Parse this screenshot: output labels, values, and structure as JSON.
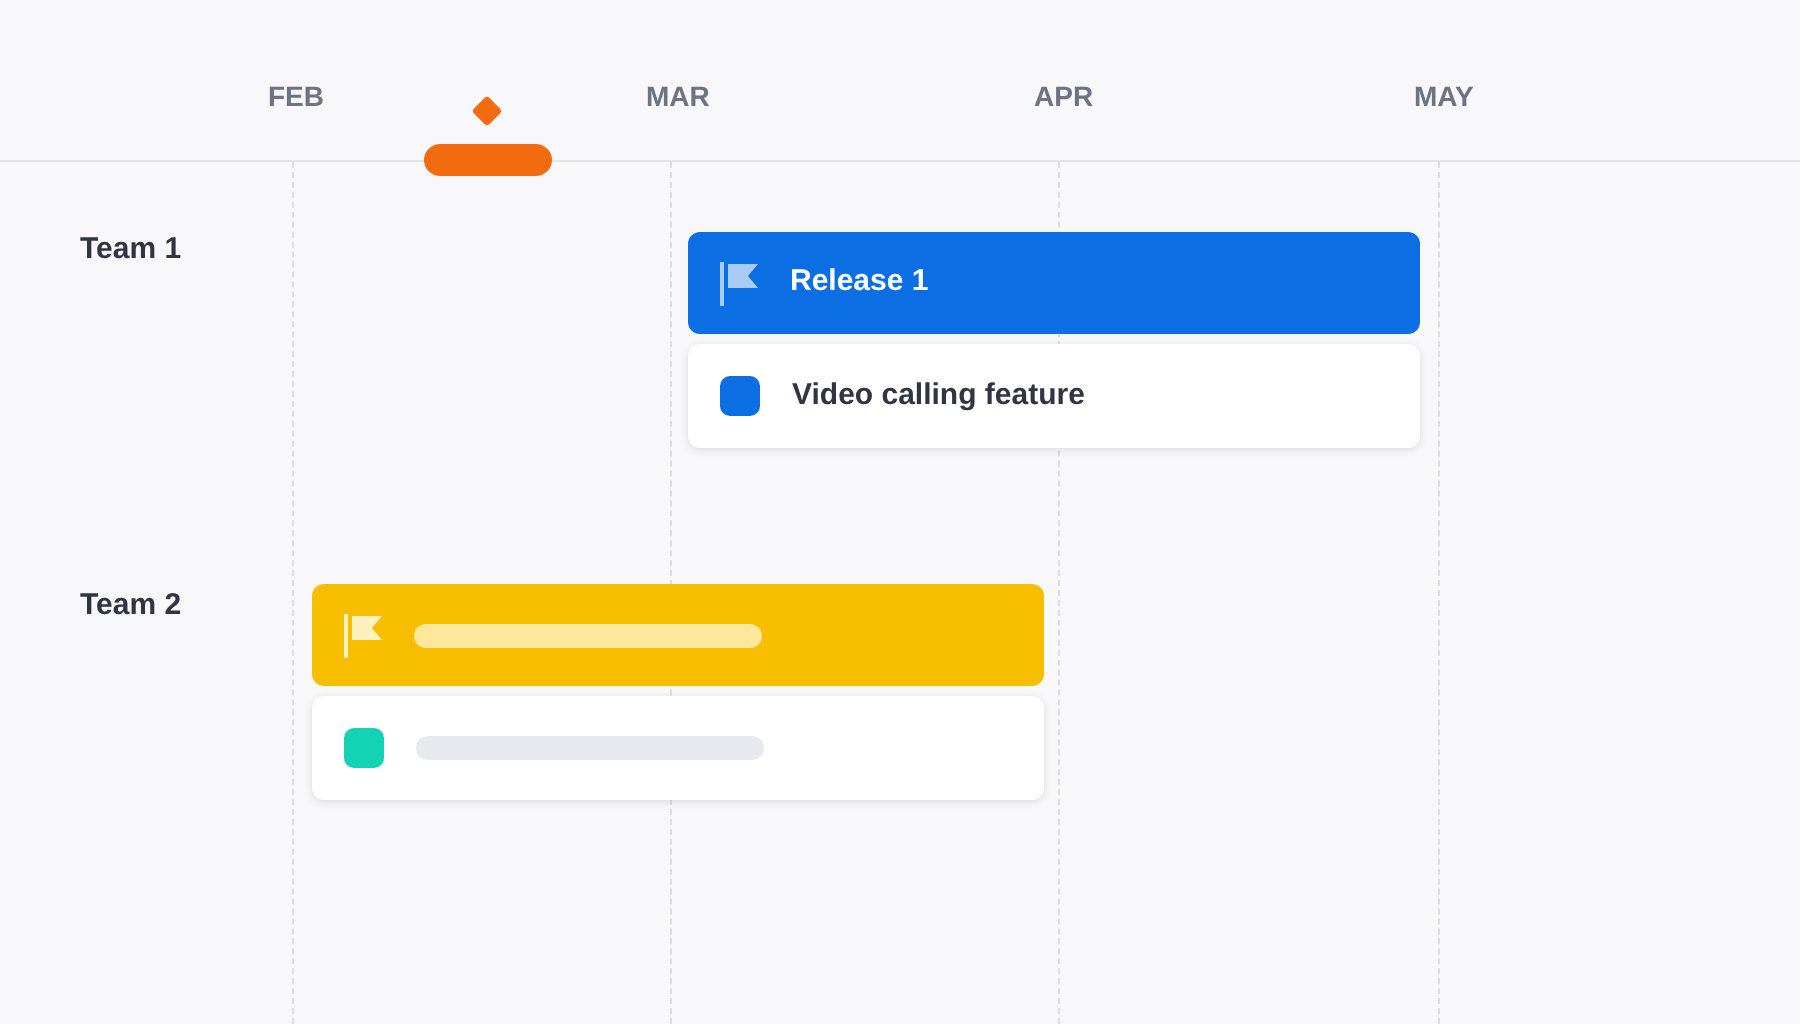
{
  "timeline": {
    "months": [
      "FEB",
      "MAR",
      "APR",
      "MAY"
    ],
    "today_marker": true
  },
  "teams": [
    {
      "name": "Team 1",
      "epic": {
        "kind": "labeled",
        "title": "Release 1",
        "color": "#0b6ee3"
      },
      "item": {
        "kind": "labeled",
        "title": "Video calling feature",
        "color": "#0b6ee3"
      }
    },
    {
      "name": "Team 2",
      "epic": {
        "kind": "skeleton",
        "color": "#f7be00"
      },
      "item": {
        "kind": "skeleton",
        "color": "#13d3b4"
      }
    }
  ]
}
